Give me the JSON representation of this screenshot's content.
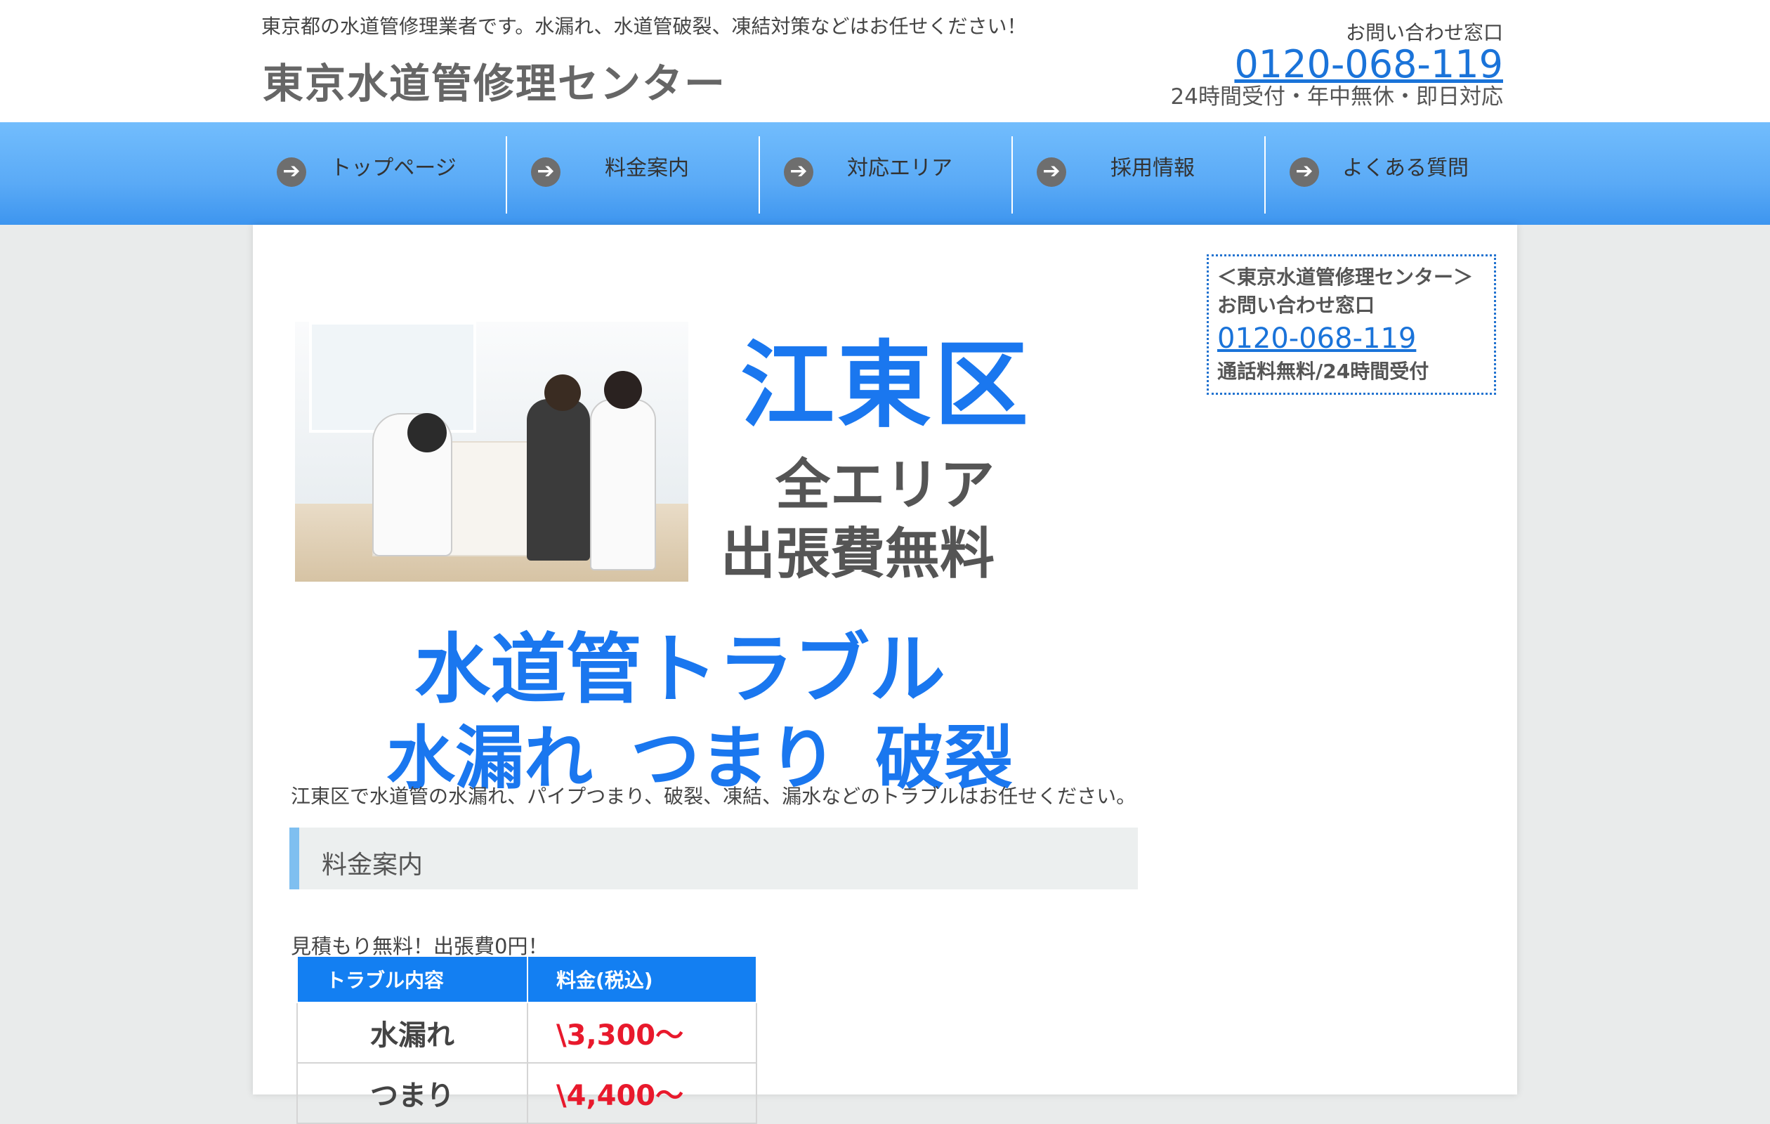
{
  "header": {
    "tagline": "東京都の水道管修理業者です。水漏れ、水道管破裂、凍結対策などはお任せください！",
    "logo": "東京水道管修理センター",
    "contact_label": "お問い合わせ窓口",
    "phone": "0120-068-119",
    "hours": "24時間受付・年中無休・即日対応"
  },
  "nav": {
    "items": [
      {
        "label": "トップページ"
      },
      {
        "label": "料金案内"
      },
      {
        "label": "対応エリア"
      },
      {
        "label": "採用情報"
      },
      {
        "label": "よくある質問"
      }
    ],
    "arrow_icon": "arrow-right-circle-icon"
  },
  "hero": {
    "area": "江東区",
    "line2": "全エリア",
    "line3": "出張費無料",
    "line4": "水道管トラブル",
    "line5": "水漏れ つまり 破裂"
  },
  "main": {
    "lead": "江東区で水道管の水漏れ、パイプつまり、破裂、凍結、漏水などのトラブルはお任せください。",
    "section_title": "料金案内",
    "note": "見積もり無料！出張費0円！",
    "table": {
      "headers": [
        "トラブル内容",
        "料金(税込)"
      ],
      "rows": [
        {
          "item": "水漏れ",
          "price": "\\3,300〜"
        },
        {
          "item": "つまり",
          "price": "\\4,400〜"
        }
      ]
    }
  },
  "sidebar": {
    "title": "＜東京水道管修理センター＞",
    "contact_label": "お問い合わせ窓口",
    "phone": "0120-068-119",
    "note": "通話料無料/24時間受付"
  },
  "colors": {
    "accent": "#1a77ef",
    "nav_top": "#72bdfd",
    "nav_bottom": "#3d95ef",
    "price_red": "#e8192c",
    "table_header": "#137ff2"
  }
}
